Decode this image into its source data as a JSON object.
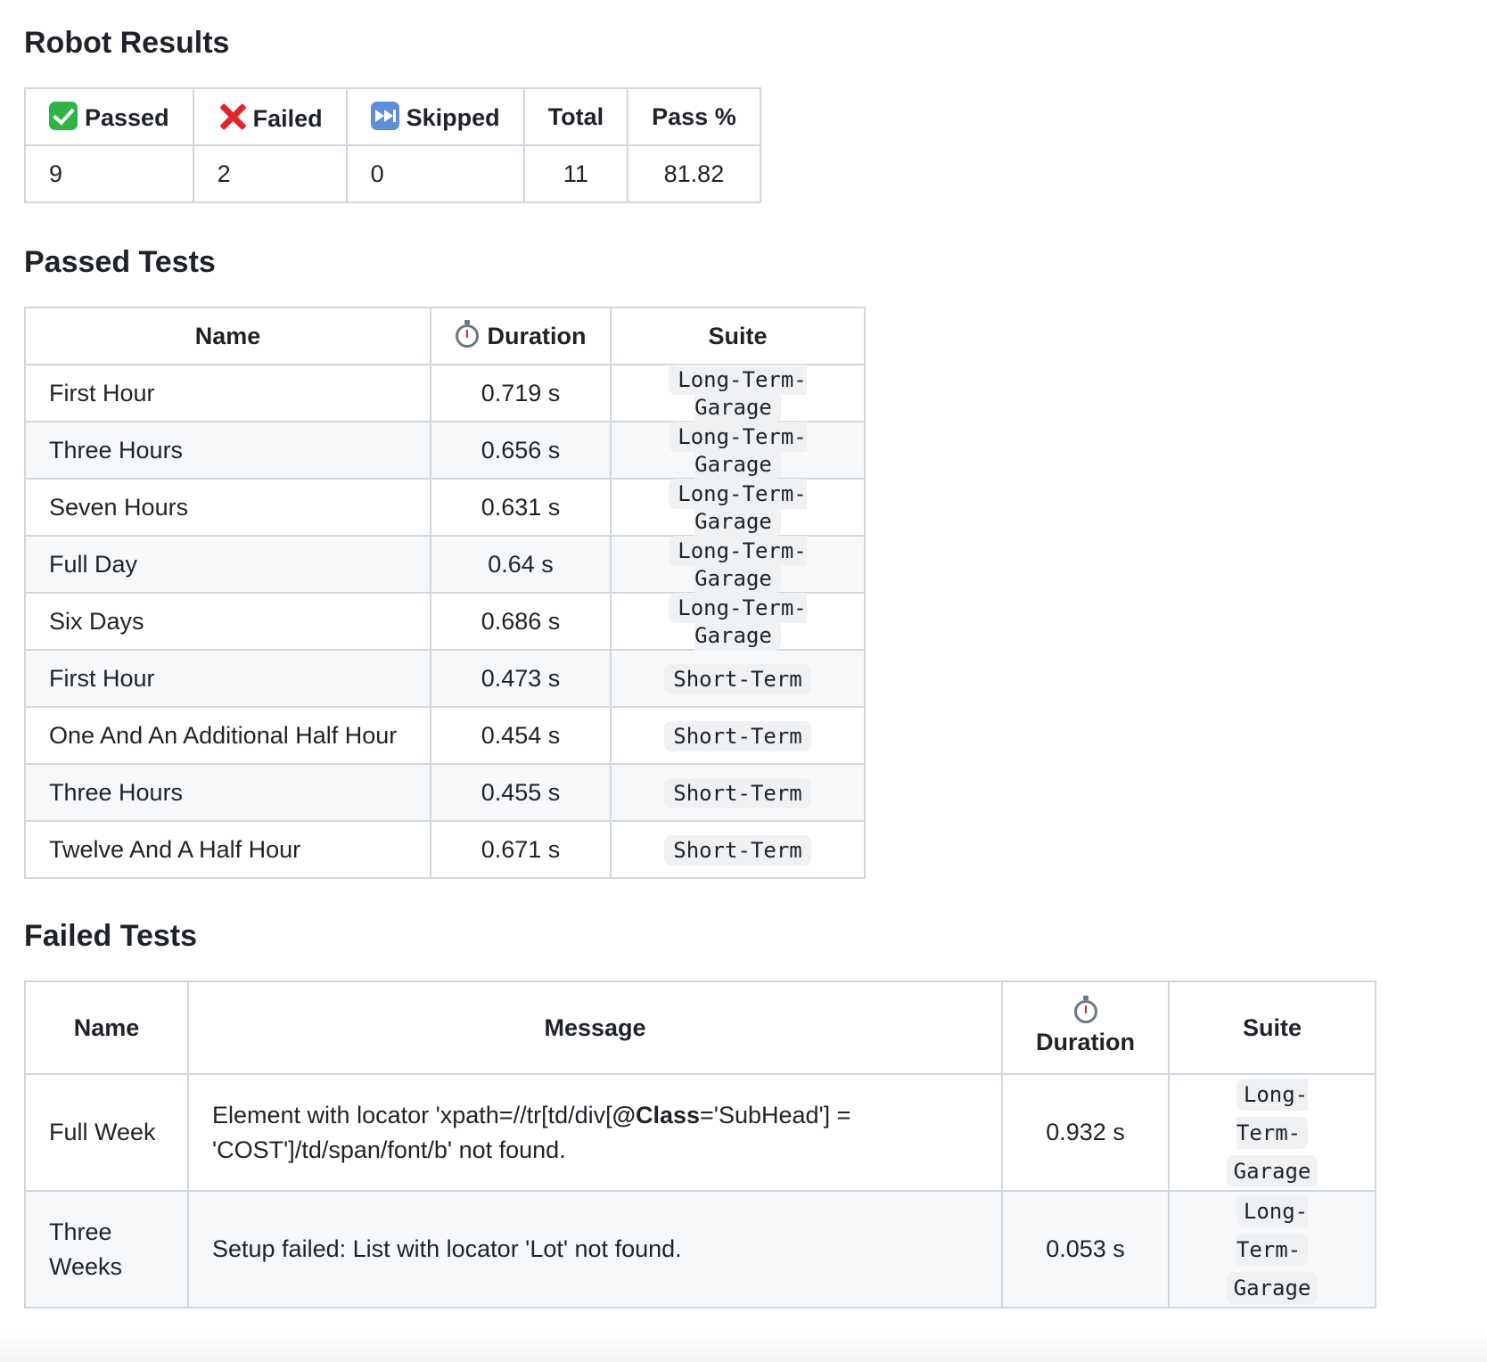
{
  "summary": {
    "title": "Robot Results",
    "headers": {
      "passed": "Passed",
      "failed": "Failed",
      "skipped": "Skipped",
      "total": "Total",
      "pass_pct": "Pass %"
    },
    "icons": {
      "passed": "check-mark-icon",
      "failed": "cross-mark-icon",
      "skipped": "fast-forward-icon"
    },
    "values": {
      "passed": "9",
      "failed": "2",
      "skipped": "0",
      "total": "11",
      "pass_pct": "81.82"
    }
  },
  "passed_tests": {
    "title": "Passed Tests",
    "headers": {
      "name": "Name",
      "duration": "Duration",
      "suite": "Suite"
    },
    "rows": [
      {
        "name": "First Hour",
        "duration": "0.719 s",
        "suite": "Long-Term-Garage"
      },
      {
        "name": "Three Hours",
        "duration": "0.656 s",
        "suite": "Long-Term-Garage"
      },
      {
        "name": "Seven Hours",
        "duration": "0.631 s",
        "suite": "Long-Term-Garage"
      },
      {
        "name": "Full Day",
        "duration": "0.64 s",
        "suite": "Long-Term-Garage"
      },
      {
        "name": "Six Days",
        "duration": "0.686 s",
        "suite": "Long-Term-Garage"
      },
      {
        "name": "First Hour",
        "duration": "0.473 s",
        "suite": "Short-Term"
      },
      {
        "name": "One And An Additional Half Hour",
        "duration": "0.454 s",
        "suite": "Short-Term"
      },
      {
        "name": "Three Hours",
        "duration": "0.455 s",
        "suite": "Short-Term"
      },
      {
        "name": "Twelve And A Half Hour",
        "duration": "0.671 s",
        "suite": "Short-Term"
      }
    ]
  },
  "failed_tests": {
    "title": "Failed Tests",
    "headers": {
      "name": "Name",
      "message": "Message",
      "duration": "Duration",
      "suite": "Suite"
    },
    "rows": [
      {
        "name": "Full Week",
        "message_pre": "Element with locator 'xpath=//tr[td/div[",
        "message_bold": "@Class",
        "message_post": "='SubHead'] = 'COST']/td/span/font/b' not found.",
        "duration": "0.932 s",
        "suite_line1": "Long-Term-",
        "suite_line2": "Garage"
      },
      {
        "name_line1": "Three",
        "name_line2": "Weeks",
        "message": "Setup failed: List with locator 'Lot' not found.",
        "duration": "0.053 s",
        "suite_line1": "Long-Term-",
        "suite_line2": "Garage"
      }
    ]
  },
  "colors": {
    "border": "#d0d7de",
    "alt_row": "#f6f8fa",
    "code_bg": "#eff1f3",
    "text": "#1f2328"
  }
}
